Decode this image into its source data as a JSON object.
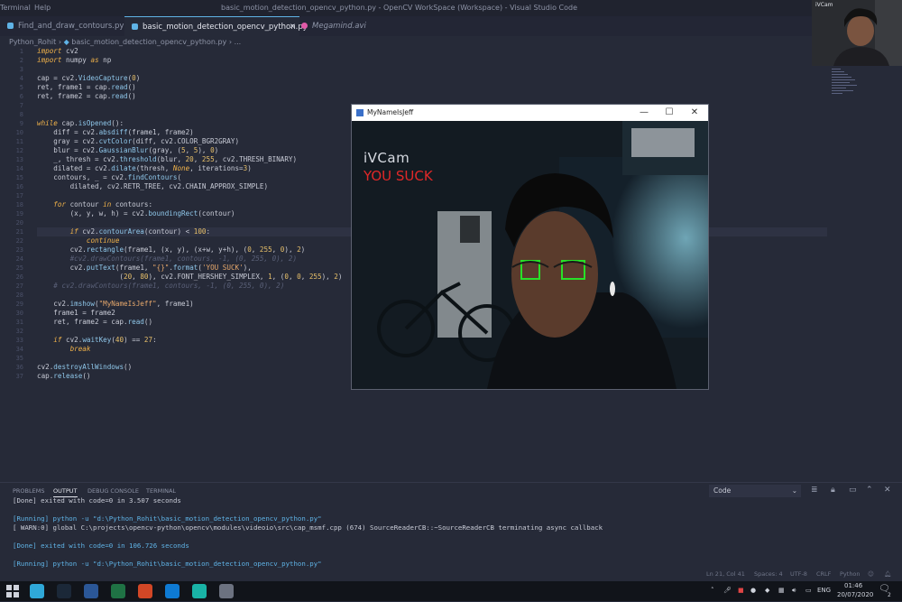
{
  "titlebar": {
    "menu": [
      "Terminal",
      "Help"
    ],
    "window_title": "basic_motion_detection_opencv_python.py - OpenCV WorkSpace (Workspace) - Visual Studio Code"
  },
  "tabs": [
    {
      "label": "Find_and_draw_contours.py",
      "color": "#5fb3e6"
    },
    {
      "label": "basic_motion_detection_opencv_python.py",
      "color": "#5fb3e6"
    },
    {
      "label": "Megamind.avi",
      "color": "#e05aa8"
    }
  ],
  "breadcrumb": [
    "Python_Rohit",
    "basic_motion_detection_opencv_python.py",
    "..."
  ],
  "line_numbers": [
    "1",
    "2",
    "3",
    "4",
    "5",
    "6",
    "7",
    "8",
    "9",
    "10",
    "11",
    "12",
    "13",
    "14",
    "15",
    "16",
    "17",
    "18",
    "19",
    "20",
    "21",
    "22",
    "23",
    "24",
    "25",
    "26",
    "27",
    "28",
    "29",
    "30",
    "31",
    "32",
    "33",
    "34",
    "35",
    "36",
    "37"
  ],
  "webcam": {
    "label": "iVCam"
  },
  "cv_window": {
    "title": "MyNameIsJeff",
    "overlay_title": "iVCam",
    "overlay_text": "YOU SUCK",
    "minimize": "—",
    "maximize": "☐",
    "close": "✕"
  },
  "panel": {
    "tabs": [
      "PROBLEMS",
      "OUTPUT",
      "DEBUG CONSOLE",
      "TERMINAL"
    ],
    "select_value": "Code",
    "output": [
      {
        "pre": "[Done] exited with code=0 in 3.507 seconds",
        "cls": ""
      },
      {
        "pre": "[Running] python -u \"d:\\Python_Rohit\\basic_motion_detection_opencv_python.py\"",
        "cls": "blue"
      },
      {
        "pre": "[ WARN:0] global C:\\projects\\opencv-python\\opencv\\modules\\videoio\\src\\cap_msmf.cpp (674) SourceReaderCB::~SourceReaderCB terminating async callback",
        "cls": ""
      },
      {
        "pre": "[Done] exited with code=0 in 106.726 seconds",
        "cls": "blue"
      },
      {
        "pre": "[Running] python -u \"d:\\Python_Rohit\\basic_motion_detection_opencv_python.py\"",
        "cls": "blue"
      }
    ]
  },
  "status": {
    "position": "Ln 21, Col 41",
    "spaces": "Spaces: 4",
    "encoding": "UTF-8",
    "eol": "CRLF",
    "language": "Python"
  },
  "taskbar": {
    "language": "ENG",
    "time": "01:46",
    "date": "20/07/2020",
    "notifications": "2",
    "apps": [
      {
        "name": "edge-icon",
        "color": "#2fa8d8"
      },
      {
        "name": "steam-icon",
        "color": "#1b2838"
      },
      {
        "name": "word-icon",
        "color": "#2b5797"
      },
      {
        "name": "excel-icon",
        "color": "#1f7244"
      },
      {
        "name": "powerpoint-icon",
        "color": "#d24726"
      },
      {
        "name": "vscode-icon",
        "color": "#0e7ad3"
      },
      {
        "name": "python-app-icon",
        "color": "#19b3a6"
      },
      {
        "name": "camera-app-icon",
        "color": "#6c7280"
      }
    ]
  }
}
